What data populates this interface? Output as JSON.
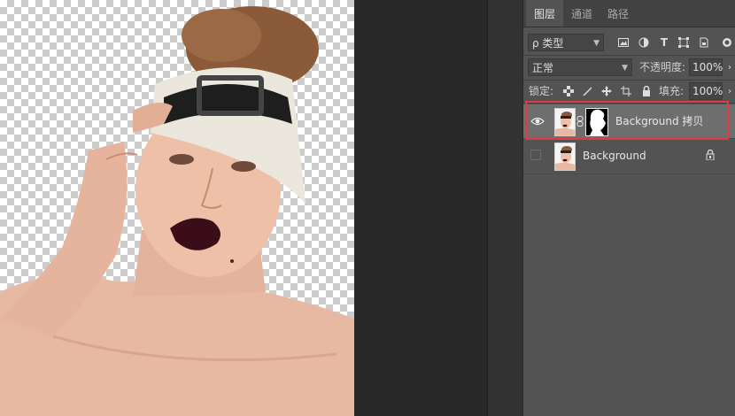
{
  "panel": {
    "tabs": [
      {
        "label": "图层",
        "active": true
      },
      {
        "label": "通道",
        "active": false
      },
      {
        "label": "路径",
        "active": false
      }
    ],
    "filter": {
      "label": "ρ 类型"
    },
    "blend_mode": {
      "value": "正常"
    },
    "opacity": {
      "label": "不透明度:",
      "value": "100%"
    },
    "lock": {
      "label": "锁定:"
    },
    "fill": {
      "label": "填充:",
      "value": "100%"
    },
    "layers": [
      {
        "name": "Background 拷贝",
        "visible": true,
        "selected": true,
        "has_mask": true,
        "locked": false
      },
      {
        "name": "Background",
        "visible": false,
        "selected": false,
        "has_mask": false,
        "locked": true
      }
    ]
  },
  "colors": {
    "panel_bg": "#535353",
    "selected_layer": "#6e6e6e",
    "highlight_border": "#e0393e",
    "workspace_bg": "#282828"
  }
}
